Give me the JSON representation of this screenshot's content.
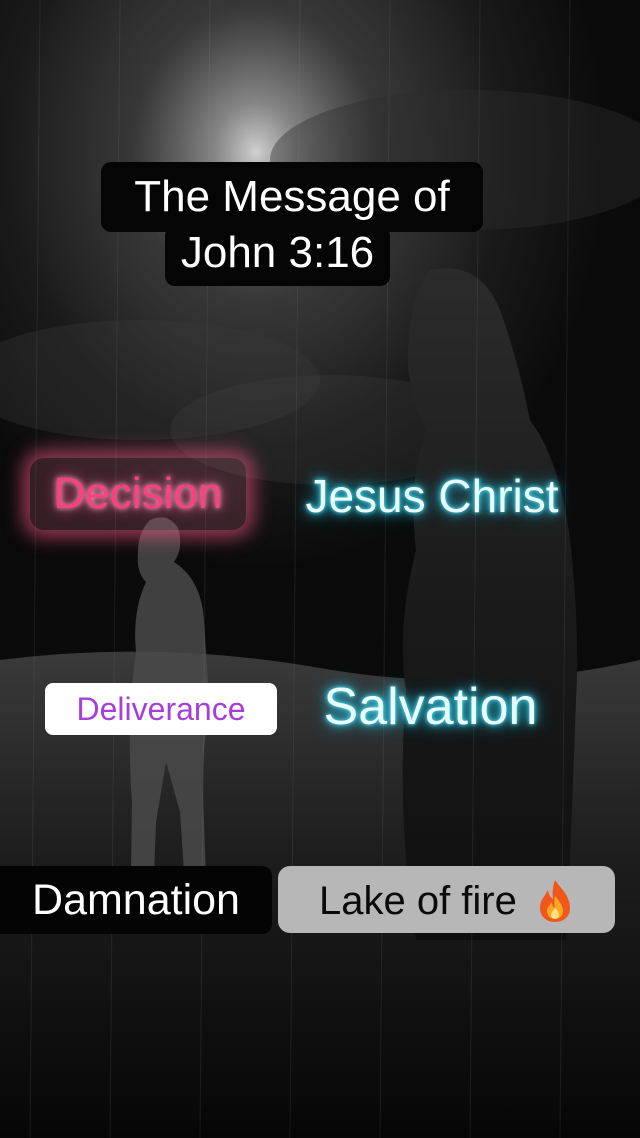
{
  "title": {
    "line1": "The Message of",
    "line2": "John 3:16"
  },
  "labels": {
    "decision": "Decision",
    "jesus_christ": "Jesus Christ",
    "deliverance": "Deliverance",
    "salvation": "Salvation",
    "damnation": "Damnation",
    "lake_of_fire": "Lake of fire"
  },
  "icons": {
    "lake_of_fire": "fire-icon"
  },
  "colors": {
    "decision_text": "#ff3f80",
    "decision_glow": "#ff5f9a",
    "neon_glow": "#2ccbe9",
    "deliverance_text": "#a63ed9",
    "lake_box": "#b7b7b7"
  }
}
